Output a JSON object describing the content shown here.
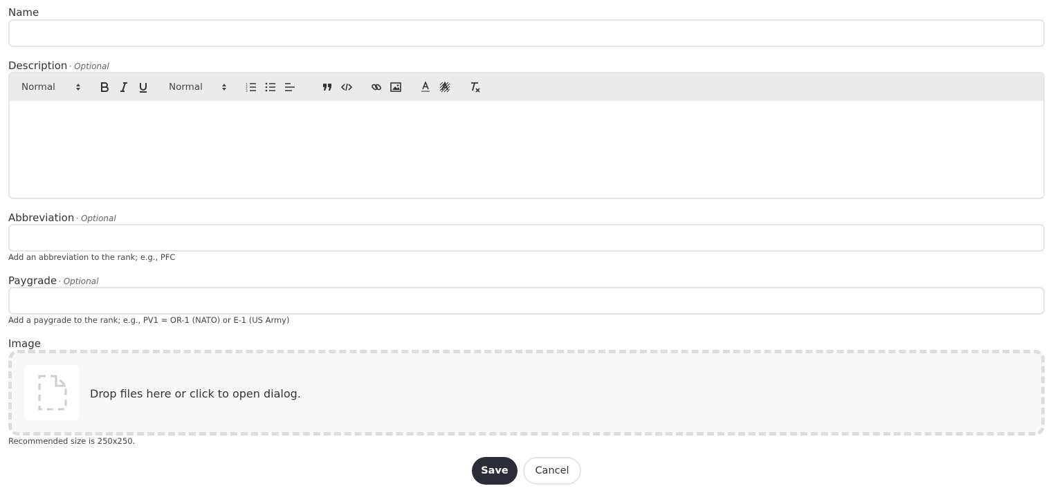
{
  "form": {
    "name": {
      "label": "Name",
      "value": ""
    },
    "description": {
      "label": "Description",
      "optional": "· Optional",
      "toolbar": {
        "header_picker": "Normal",
        "size_picker": "Normal",
        "icons": [
          "bold-icon",
          "italic-icon",
          "underline-icon",
          "ordered-list-icon",
          "bullet-list-icon",
          "align-icon",
          "blockquote-icon",
          "code-block-icon",
          "link-icon",
          "image-icon",
          "text-color-icon",
          "background-color-icon",
          "clear-format-icon"
        ]
      }
    },
    "abbreviation": {
      "label": "Abbreviation",
      "optional": "· Optional",
      "value": "",
      "help": "Add an abbreviation to the rank; e.g., PFC"
    },
    "paygrade": {
      "label": "Paygrade",
      "optional": "· Optional",
      "value": "",
      "help": "Add a paygrade to the rank; e.g., PV1 = OR-1 (NATO) or E-1 (US Army)"
    },
    "image": {
      "label": "Image",
      "dropzone_text": "Drop files here or click to open dialog.",
      "help": "Recommended size is 250x250.",
      "icon": "file-placeholder-icon"
    }
  },
  "actions": {
    "save": "Save",
    "cancel": "Cancel"
  },
  "colors": {
    "primary_button": "#2b2d36",
    "border": "#e5e5e5",
    "toolbar_bg": "#ebebeb",
    "dropzone_bg": "#f8f8f8"
  }
}
